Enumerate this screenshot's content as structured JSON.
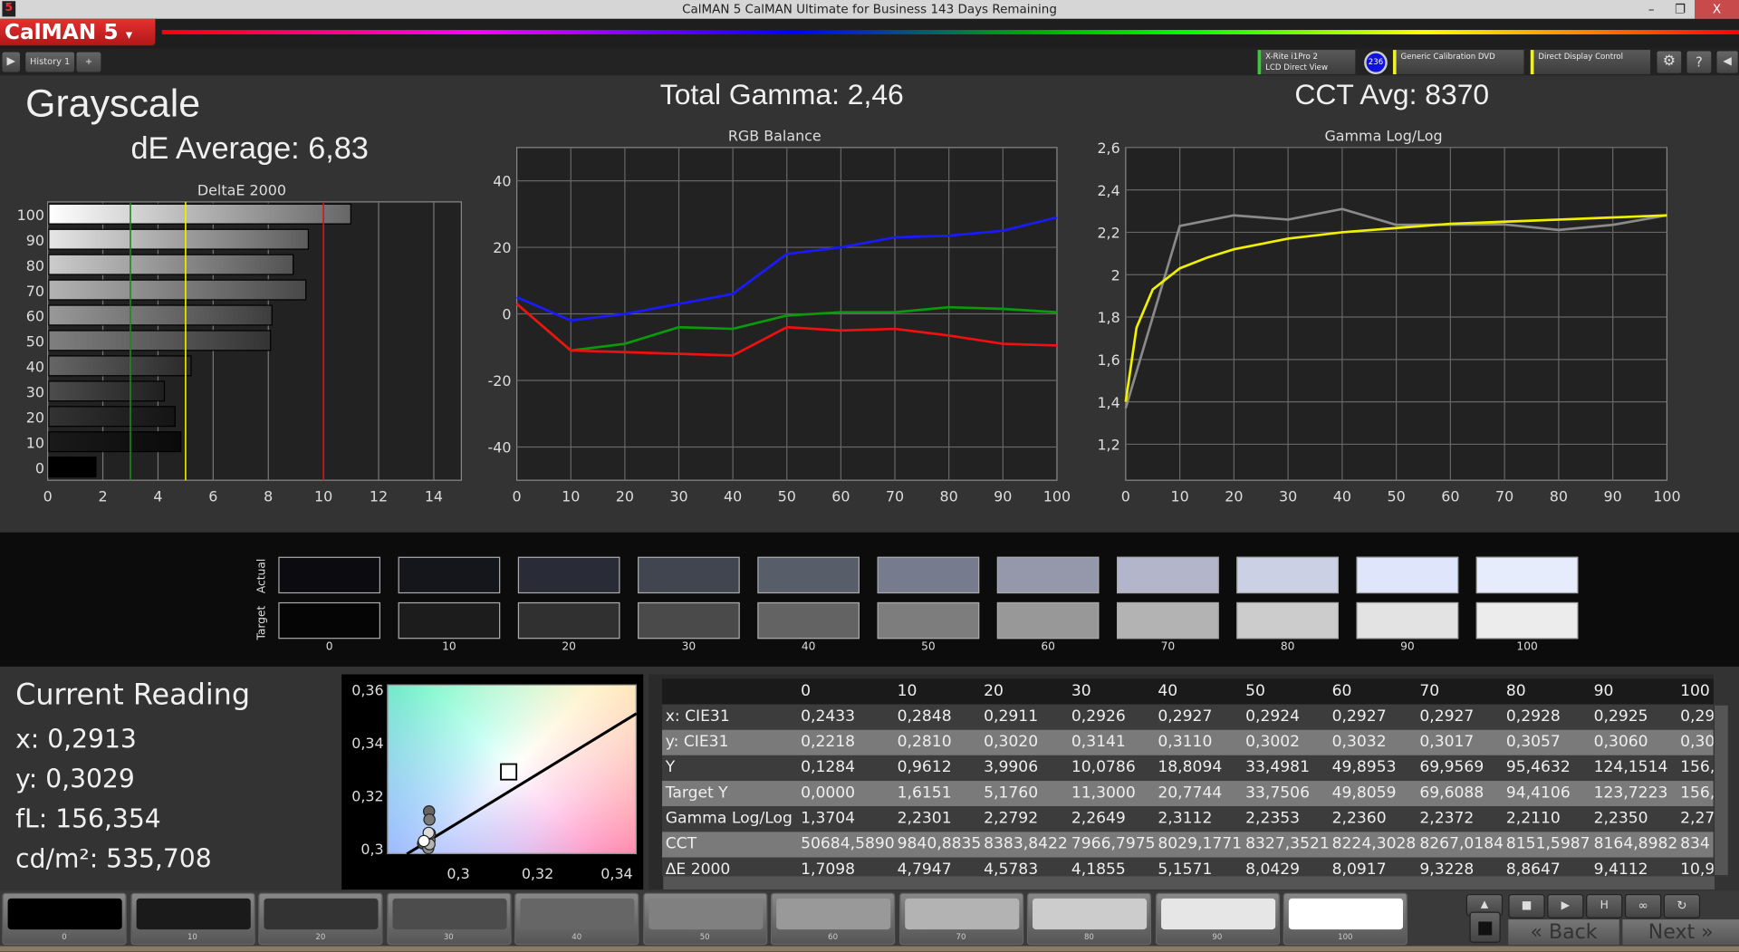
{
  "window": {
    "title": "CalMAN 5 CalMAN Ultimate for Business 143 Days Remaining",
    "app_icon": "5",
    "minimize": "–",
    "maximize": "❐",
    "close": "X"
  },
  "logo": {
    "text": "CalMAN 5",
    "dropdown": "▾"
  },
  "toolbar": {
    "history_tab": "History 1",
    "add_tab": "+",
    "devices": [
      {
        "line1": "X-Rite i1Pro 2",
        "line2": "LCD Direct View",
        "accent": "#3c3"
      },
      {
        "line1": "Generic Calibration DVD",
        "line2": "",
        "accent": "#ee3"
      },
      {
        "line1": "Direct Display Control",
        "line2": "",
        "accent": "#ee3"
      }
    ],
    "badge": "236"
  },
  "header": {
    "page_title": "Grayscale",
    "de_average": "dE Average: 6,83",
    "total_gamma": "Total Gamma: 2,46",
    "cct_avg": "CCT Avg: 8370"
  },
  "chart_data": [
    {
      "type": "bar",
      "title": "DeltaE 2000",
      "orientation": "horizontal",
      "categories": [
        "0",
        "10",
        "20",
        "30",
        "40",
        "50",
        "60",
        "70",
        "80",
        "90",
        "100"
      ],
      "values": [
        1.71,
        4.79,
        4.58,
        4.19,
        5.16,
        8.04,
        8.09,
        9.32,
        8.86,
        9.41,
        10.95
      ],
      "xlim": [
        0,
        15
      ],
      "xticks": [
        "0",
        "2",
        "4",
        "6",
        "8",
        "10",
        "12",
        "14"
      ],
      "thresholds": [
        {
          "value": 3,
          "color": "#1a8a1a"
        },
        {
          "value": 5,
          "color": "#f0f000"
        },
        {
          "value": 10,
          "color": "#e01010"
        }
      ],
      "grid": true
    },
    {
      "type": "line",
      "title": "RGB Balance",
      "x": [
        0,
        10,
        20,
        30,
        40,
        50,
        60,
        70,
        80,
        90,
        100
      ],
      "ylim": [
        -50,
        50
      ],
      "yticks": [
        "40",
        "20",
        "0",
        "-20",
        "-40"
      ],
      "xticks": [
        "0",
        "10",
        "20",
        "30",
        "40",
        "50",
        "60",
        "70",
        "80",
        "90",
        "100"
      ],
      "series": [
        {
          "color": "#1a1aff",
          "values": [
            5,
            -2,
            0,
            3,
            6,
            18,
            20,
            23,
            23.5,
            25,
            29
          ]
        },
        {
          "color": "#0a9a0a",
          "values": [
            3,
            -11,
            -9,
            -4,
            -4.5,
            -0.5,
            0.5,
            0.5,
            2,
            1.5,
            0.5
          ]
        },
        {
          "color": "#f01010",
          "values": [
            3,
            -11,
            -11.5,
            -12,
            -12.5,
            -4,
            -5,
            -4.5,
            -6.5,
            -9,
            -9.5
          ]
        }
      ],
      "grid": true
    },
    {
      "type": "line",
      "title": "Gamma Log/Log",
      "ylim": [
        1.03,
        2.6
      ],
      "yticks": [
        "2,6",
        "2,4",
        "2,2",
        "2",
        "1,8",
        "1,6",
        "1,4",
        "1,2"
      ],
      "xticks": [
        "0",
        "10",
        "20",
        "30",
        "40",
        "50",
        "60",
        "70",
        "80",
        "90",
        "100"
      ],
      "series": [
        {
          "color": "#8a8a8a",
          "x": [
            0,
            10,
            20,
            30,
            40,
            50,
            60,
            70,
            80,
            90,
            100
          ],
          "values": [
            1.37,
            2.23,
            2.28,
            2.26,
            2.31,
            2.235,
            2.236,
            2.237,
            2.211,
            2.235,
            2.28
          ]
        },
        {
          "color": "#f0f000",
          "x": [
            0,
            2,
            5,
            10,
            15,
            20,
            30,
            40,
            50,
            60,
            70,
            80,
            90,
            100
          ],
          "values": [
            1.4,
            1.75,
            1.93,
            2.03,
            2.08,
            2.12,
            2.17,
            2.2,
            2.22,
            2.24,
            2.25,
            2.26,
            2.27,
            2.28
          ]
        }
      ],
      "grid": true
    },
    {
      "type": "scatter",
      "title": "",
      "xlim": [
        0.282,
        0.345
      ],
      "ylim": [
        0.298,
        0.362
      ],
      "xticks": [
        "0,3",
        "0,32",
        "0,34"
      ],
      "yticks": [
        "0,36",
        "0,34",
        "0,32",
        "0,3"
      ],
      "points_x": [
        0.2848,
        0.2911,
        0.2926,
        0.2927,
        0.2924,
        0.2927,
        0.2927,
        0.2928,
        0.2925,
        0.2913
      ],
      "points_y": [
        0.281,
        0.302,
        0.3141,
        0.311,
        0.3002,
        0.3032,
        0.3017,
        0.3057,
        0.306,
        0.3029
      ],
      "target": [
        0.3127,
        0.329
      ],
      "locus": [
        [
          0.287,
          0.298
        ],
        [
          0.345,
          0.351
        ]
      ]
    }
  ],
  "swatches": {
    "actual_label": "Actual",
    "target_label": "Target",
    "labels": [
      "0",
      "10",
      "20",
      "30",
      "40",
      "50",
      "60",
      "70",
      "80",
      "90",
      "100"
    ],
    "actual": [
      "#0b0b10",
      "#15151c",
      "#292c36",
      "#404550",
      "#585d6a",
      "#777b8e",
      "#9498aa",
      "#b3b6cb",
      "#cbd0e4",
      "#dfe6fb",
      "#e6ecfc"
    ],
    "target": [
      "#050505",
      "#1c1c1c",
      "#303030",
      "#4a4a4a",
      "#636363",
      "#7d7d7d",
      "#989898",
      "#b3b3b3",
      "#cccccc",
      "#e3e3e3",
      "#ececec"
    ]
  },
  "reading": {
    "title": "Current Reading",
    "x": "x: 0,2913",
    "y": "y: 0,3029",
    "fl": "fL: 156,354",
    "cdm2": "cd/m²: 535,708"
  },
  "table": {
    "columns": [
      "",
      "0",
      "10",
      "20",
      "30",
      "40",
      "50",
      "60",
      "70",
      "80",
      "90",
      "100"
    ],
    "rows": [
      [
        "x: CIE31",
        "0,2433",
        "0,2848",
        "0,2911",
        "0,2926",
        "0,2927",
        "0,2924",
        "0,2927",
        "0,2927",
        "0,2928",
        "0,2925",
        "0,29"
      ],
      [
        "y: CIE31",
        "0,2218",
        "0,2810",
        "0,3020",
        "0,3141",
        "0,3110",
        "0,3002",
        "0,3032",
        "0,3017",
        "0,3057",
        "0,3060",
        "0,30"
      ],
      [
        "Y",
        "0,1284",
        "0,9612",
        "3,9906",
        "10,0786",
        "18,8094",
        "33,4981",
        "49,8953",
        "69,9569",
        "95,4632",
        "124,1514",
        "156,"
      ],
      [
        "Target Y",
        "0,0000",
        "1,6151",
        "5,1760",
        "11,3000",
        "20,7744",
        "33,7506",
        "49,8059",
        "69,6088",
        "94,4106",
        "123,7223",
        "156,"
      ],
      [
        "Gamma Log/Log",
        "1,3704",
        "2,2301",
        "2,2792",
        "2,2649",
        "2,3112",
        "2,2353",
        "2,2360",
        "2,2372",
        "2,2110",
        "2,2350",
        "2,27"
      ],
      [
        "CCT",
        "50684,5890",
        "9840,8835",
        "8383,8422",
        "7966,7975",
        "8029,1771",
        "8327,3521",
        "8224,3028",
        "8267,0184",
        "8151,5987",
        "8164,8982",
        "834"
      ],
      [
        "ΔE 2000",
        "1,7098",
        "4,7947",
        "4,5783",
        "4,1855",
        "5,1571",
        "8,0429",
        "8,0917",
        "9,3228",
        "8,8647",
        "9,4112",
        "10,9"
      ]
    ]
  },
  "bottom": {
    "swatch_labels": [
      "0",
      "10",
      "20",
      "30",
      "40",
      "50",
      "60",
      "70",
      "80",
      "90",
      "100"
    ],
    "swatch_colors": [
      "#000000",
      "#1a1a1a",
      "#333333",
      "#4c4c4c",
      "#666666",
      "#808080",
      "#999999",
      "#b3b3b3",
      "#cccccc",
      "#e6e6e6",
      "#ffffff"
    ],
    "back": "Back",
    "next": "Next"
  }
}
